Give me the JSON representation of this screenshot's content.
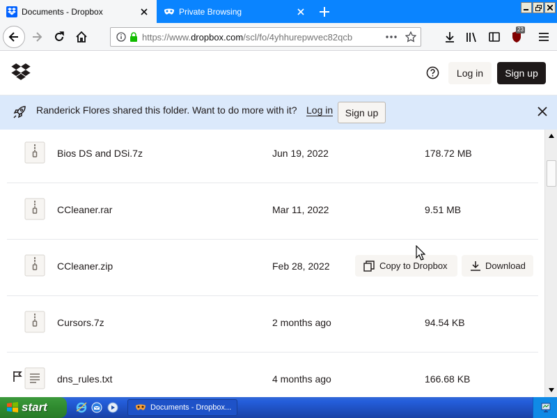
{
  "browser": {
    "tabs": [
      {
        "title": "Documents - Dropbox",
        "active": true
      },
      {
        "title": "Private Browsing",
        "active": false
      }
    ],
    "url_prefix": "https://www.",
    "url_domain": "dropbox.com",
    "url_rest": "/scl/fo/4yhhurepwvec82qcb",
    "ublock_count": "23"
  },
  "header": {
    "login_label": "Log in",
    "signup_label": "Sign up"
  },
  "banner": {
    "text": "Randerick Flores shared this folder. Want to do more with it?",
    "login_label": "Log in",
    "signup_label": "Sign up"
  },
  "files": [
    {
      "name": "Bios DS and DSi.7z",
      "date": "Jun 19, 2022",
      "size": "178.72 MB"
    },
    {
      "name": "CCleaner.rar",
      "date": "Mar 11, 2022",
      "size": "9.51 MB"
    },
    {
      "name": "CCleaner.zip",
      "date": "Feb 28, 2022",
      "size": ""
    },
    {
      "name": "Cursors.7z",
      "date": "2 months ago",
      "size": "94.54 KB"
    },
    {
      "name": "dns_rules.txt",
      "date": "4 months ago",
      "size": "166.68 KB"
    }
  ],
  "hover_actions": {
    "copy_label": "Copy to Dropbox",
    "download_label": "Download"
  },
  "taskbar": {
    "start_label": "start",
    "task_label": "Documents - Dropbox..."
  },
  "colors": {
    "tabstrip": "#0a84ff",
    "banner": "#dbe9fb",
    "signup": "#1e1919",
    "taskbar": "#245edb",
    "start": "#2f8a2f"
  }
}
